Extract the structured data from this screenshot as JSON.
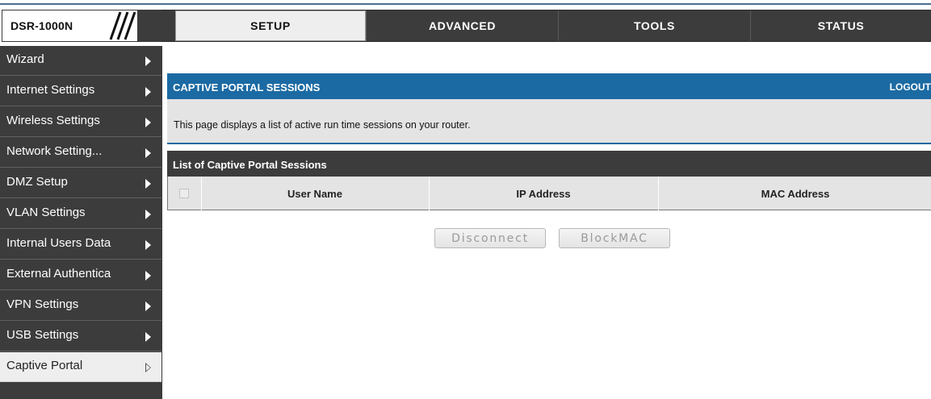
{
  "brand": {
    "model": "DSR-1000N"
  },
  "nav": {
    "tabs": [
      {
        "label": "SETUP",
        "active": true
      },
      {
        "label": "ADVANCED",
        "active": false
      },
      {
        "label": "TOOLS",
        "active": false
      },
      {
        "label": "STATUS",
        "active": false
      }
    ]
  },
  "sidebar": {
    "items": [
      {
        "label": "Wizard"
      },
      {
        "label": "Internet Settings"
      },
      {
        "label": "Wireless Settings"
      },
      {
        "label": "Network Setting..."
      },
      {
        "label": "DMZ Setup"
      },
      {
        "label": "VLAN Settings"
      },
      {
        "label": "Internal Users Data"
      },
      {
        "label": "External Authentica"
      },
      {
        "label": "VPN Settings"
      },
      {
        "label": "USB Settings"
      },
      {
        "label": "Captive Portal",
        "active": true
      }
    ]
  },
  "main": {
    "section_title": "CAPTIVE PORTAL SESSIONS",
    "logout": "LOGOUT",
    "description": "This page displays a list of active run time sessions on your router.",
    "list_title": "List of Captive Portal Sessions",
    "table": {
      "columns": [
        "User Name",
        "IP Address",
        "MAC Address"
      ],
      "rows": []
    },
    "buttons": {
      "disconnect": "Disconnect",
      "blockmac": "BlockMAC"
    }
  },
  "colors": {
    "header_blue": "#1b6aa3",
    "dark_gray": "#3c3c3c",
    "light_gray": "#e4e4e4"
  }
}
